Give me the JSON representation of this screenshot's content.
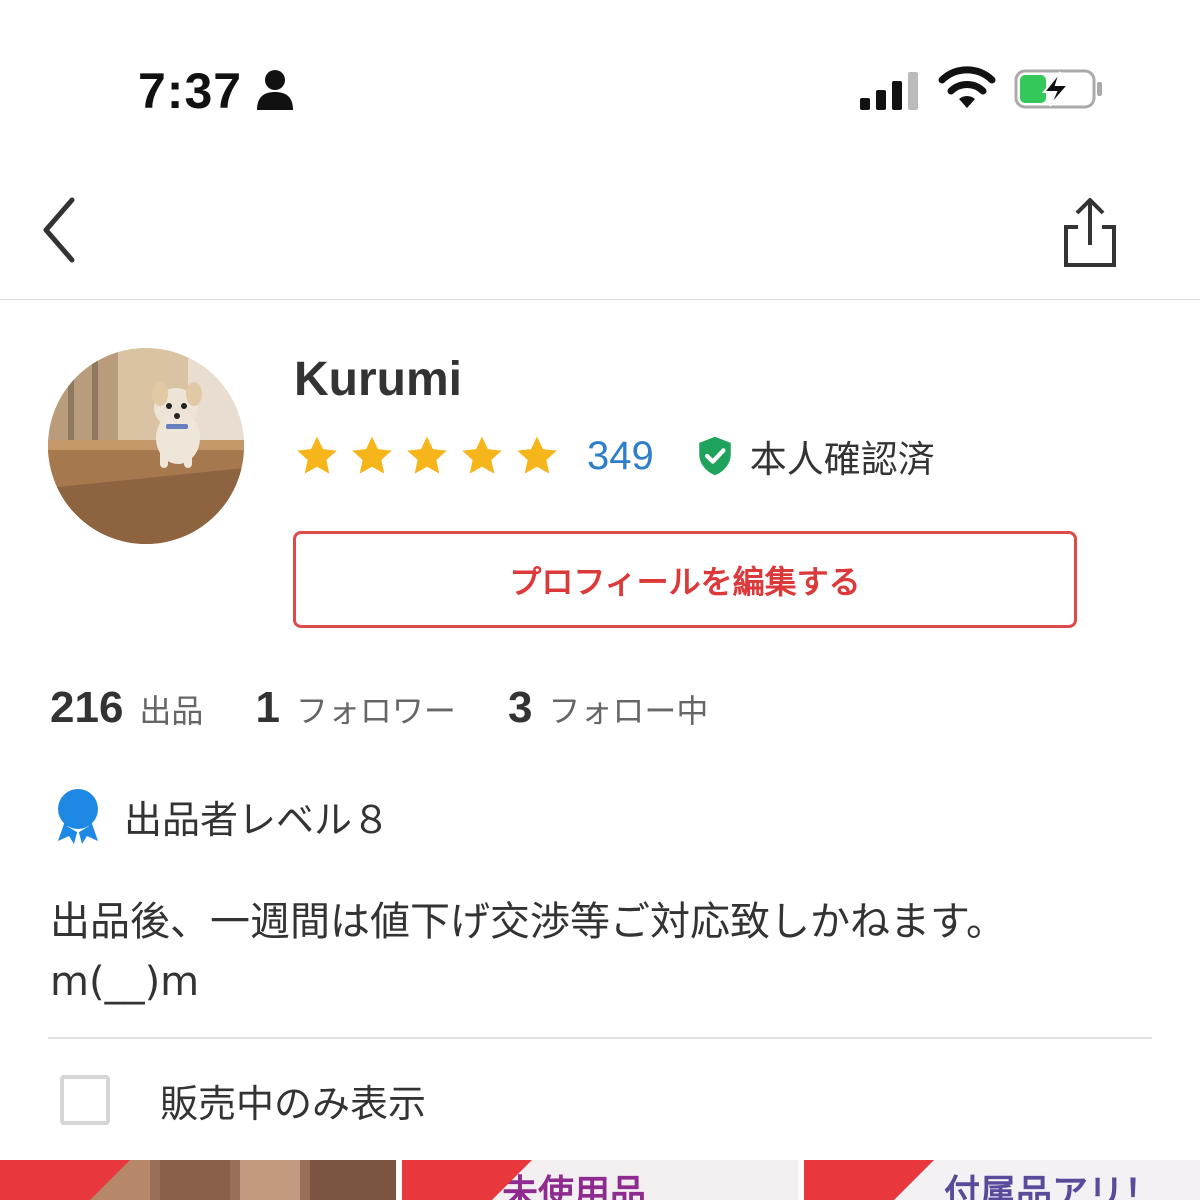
{
  "status_bar": {
    "time": "7:37"
  },
  "profile": {
    "name": "Kurumi",
    "rating_stars": 5,
    "review_count": "349",
    "verified_label": "本人確認済",
    "edit_button_label": "プロフィールを編集する"
  },
  "stats": [
    {
      "num": "216",
      "label": "出品"
    },
    {
      "num": "1",
      "label": "フォロワー"
    },
    {
      "num": "3",
      "label": "フォロー中"
    }
  ],
  "seller_level": {
    "label": "出品者レベル８"
  },
  "bio": "出品後、一週間は値下げ交渉等ご対応致しかねます。\nm(__)m",
  "filter": {
    "label": "販売中のみ表示",
    "checked": false
  },
  "items": [
    {
      "text": ""
    },
    {
      "text": "未使用品"
    },
    {
      "text": "付属品アリ！"
    }
  ],
  "colors": {
    "accent_red": "#dc3a3a",
    "link_blue": "#2f7fc8",
    "star_yellow": "#f7b51c",
    "verified_green": "#1fa35c",
    "badge_blue": "#1e88e5"
  },
  "icons": [
    "person-icon",
    "signal-icon",
    "wifi-icon",
    "battery-icon",
    "back-chevron-icon",
    "share-icon",
    "star-icon",
    "verified-shield-icon",
    "level-badge-icon"
  ]
}
